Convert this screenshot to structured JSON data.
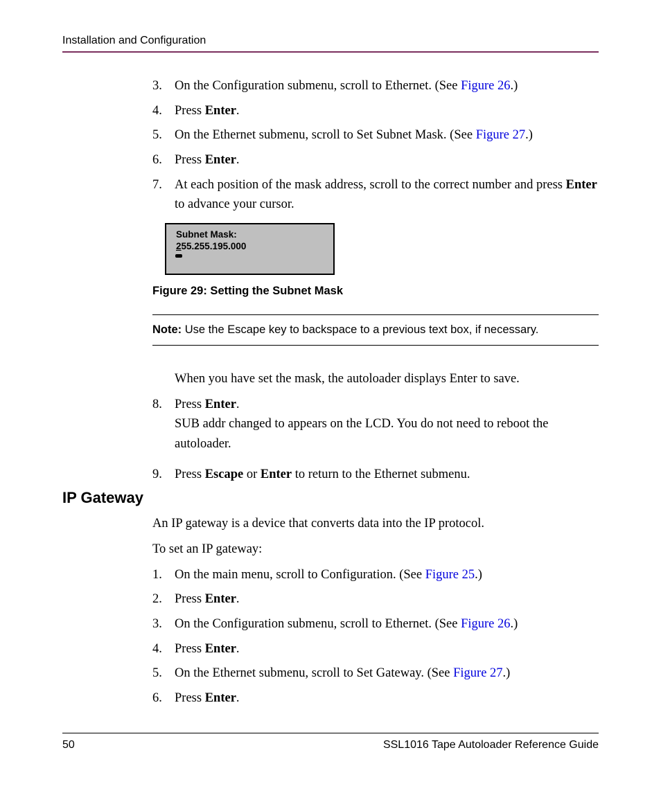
{
  "header": {
    "title": "Installation and Configuration"
  },
  "steps_a": [
    {
      "num": "3.",
      "pre": "On the Configuration submenu, scroll to Ethernet. (See ",
      "link": "Figure 26",
      "post": ".)"
    },
    {
      "num": "4.",
      "pre": "Press ",
      "bold": "Enter",
      "post": "."
    },
    {
      "num": "5.",
      "pre": "On the Ethernet submenu, scroll to Set Subnet Mask. (See ",
      "link": "Figure 27",
      "post": ".)"
    },
    {
      "num": "6.",
      "pre": "Press ",
      "bold": "Enter",
      "post": "."
    },
    {
      "num": "7.",
      "pre": "At each position of the mask address, scroll to the correct number and press ",
      "bold": "Enter",
      "post": " to advance your cursor."
    }
  ],
  "lcd": {
    "line1": "Subnet Mask:",
    "cursor": "2",
    "line2_rest": "55.255.195.000"
  },
  "figcaption": "Figure 29:  Setting the Subnet Mask",
  "note": {
    "label": "Note:",
    "text": "  Use the Escape key to backspace to a previous text box, if necessary."
  },
  "para_after_note": "When you have set the mask, the autoloader displays Enter to save.",
  "steps_b": [
    {
      "num": "8.",
      "pre": "Press ",
      "bold": "Enter",
      "post": ".",
      "sub": "SUB addr changed to appears on the LCD. You do not need to reboot the autoloader."
    },
    {
      "num": "9.",
      "pre": "Press ",
      "bold": "Escape",
      "mid": " or ",
      "bold2": "Enter",
      "post": " to return to the Ethernet submenu."
    }
  ],
  "section": {
    "heading": "IP Gateway",
    "intro1": "An IP gateway is a device that converts data into the IP protocol.",
    "intro2": "To set an IP gateway:",
    "steps": [
      {
        "num": "1.",
        "pre": "On the main menu, scroll to Configuration. (See ",
        "link": "Figure 25",
        "post": ".)"
      },
      {
        "num": "2.",
        "pre": "Press ",
        "bold": "Enter",
        "post": "."
      },
      {
        "num": "3.",
        "pre": "On the Configuration submenu, scroll to Ethernet. (See ",
        "link": "Figure 26",
        "post": ".)"
      },
      {
        "num": "4.",
        "pre": "Press ",
        "bold": "Enter",
        "post": "."
      },
      {
        "num": "5.",
        "pre": "On the Ethernet submenu, scroll to Set Gateway. (See ",
        "link": "Figure 27",
        "post": ".)"
      },
      {
        "num": "6.",
        "pre": "Press ",
        "bold": "Enter",
        "post": "."
      }
    ]
  },
  "footer": {
    "page": "50",
    "doc": "SSL1016 Tape Autoloader Reference Guide"
  }
}
